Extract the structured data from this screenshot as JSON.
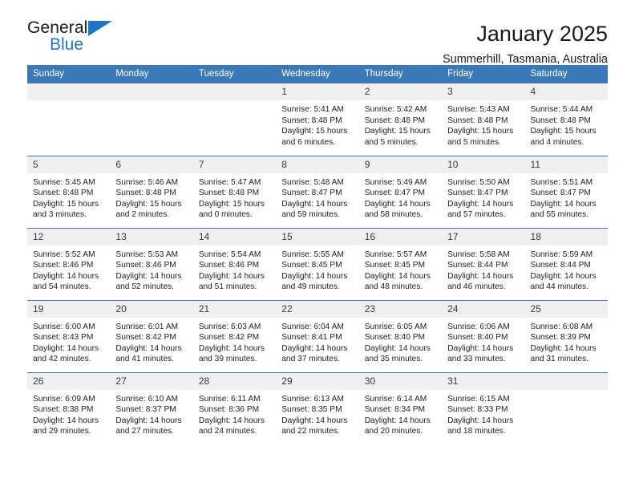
{
  "brand": {
    "name_top": "General",
    "name_bottom": "Blue",
    "triangle_color": "#1e76c8"
  },
  "header": {
    "title": "January 2025",
    "subtitle": "Summerhill, Tasmania, Australia",
    "accent_color": "#3b78b8",
    "daynum_band_color": "#f0f0f0"
  },
  "weekday_headers": [
    "Sunday",
    "Monday",
    "Tuesday",
    "Wednesday",
    "Thursday",
    "Friday",
    "Saturday"
  ],
  "labels": {
    "sunrise": "Sunrise:",
    "sunset": "Sunset:",
    "daylight": "Daylight:"
  },
  "weeks": [
    [
      {
        "day": "",
        "empty": true
      },
      {
        "day": "",
        "empty": true
      },
      {
        "day": "",
        "empty": true
      },
      {
        "day": "1",
        "sunrise": "Sunrise: 5:41 AM",
        "sunset": "Sunset: 8:48 PM",
        "daylight": "Daylight: 15 hours and 6 minutes."
      },
      {
        "day": "2",
        "sunrise": "Sunrise: 5:42 AM",
        "sunset": "Sunset: 8:48 PM",
        "daylight": "Daylight: 15 hours and 5 minutes."
      },
      {
        "day": "3",
        "sunrise": "Sunrise: 5:43 AM",
        "sunset": "Sunset: 8:48 PM",
        "daylight": "Daylight: 15 hours and 5 minutes."
      },
      {
        "day": "4",
        "sunrise": "Sunrise: 5:44 AM",
        "sunset": "Sunset: 8:48 PM",
        "daylight": "Daylight: 15 hours and 4 minutes."
      }
    ],
    [
      {
        "day": "5",
        "sunrise": "Sunrise: 5:45 AM",
        "sunset": "Sunset: 8:48 PM",
        "daylight": "Daylight: 15 hours and 3 minutes."
      },
      {
        "day": "6",
        "sunrise": "Sunrise: 5:46 AM",
        "sunset": "Sunset: 8:48 PM",
        "daylight": "Daylight: 15 hours and 2 minutes."
      },
      {
        "day": "7",
        "sunrise": "Sunrise: 5:47 AM",
        "sunset": "Sunset: 8:48 PM",
        "daylight": "Daylight: 15 hours and 0 minutes."
      },
      {
        "day": "8",
        "sunrise": "Sunrise: 5:48 AM",
        "sunset": "Sunset: 8:47 PM",
        "daylight": "Daylight: 14 hours and 59 minutes."
      },
      {
        "day": "9",
        "sunrise": "Sunrise: 5:49 AM",
        "sunset": "Sunset: 8:47 PM",
        "daylight": "Daylight: 14 hours and 58 minutes."
      },
      {
        "day": "10",
        "sunrise": "Sunrise: 5:50 AM",
        "sunset": "Sunset: 8:47 PM",
        "daylight": "Daylight: 14 hours and 57 minutes."
      },
      {
        "day": "11",
        "sunrise": "Sunrise: 5:51 AM",
        "sunset": "Sunset: 8:47 PM",
        "daylight": "Daylight: 14 hours and 55 minutes."
      }
    ],
    [
      {
        "day": "12",
        "sunrise": "Sunrise: 5:52 AM",
        "sunset": "Sunset: 8:46 PM",
        "daylight": "Daylight: 14 hours and 54 minutes."
      },
      {
        "day": "13",
        "sunrise": "Sunrise: 5:53 AM",
        "sunset": "Sunset: 8:46 PM",
        "daylight": "Daylight: 14 hours and 52 minutes."
      },
      {
        "day": "14",
        "sunrise": "Sunrise: 5:54 AM",
        "sunset": "Sunset: 8:46 PM",
        "daylight": "Daylight: 14 hours and 51 minutes."
      },
      {
        "day": "15",
        "sunrise": "Sunrise: 5:55 AM",
        "sunset": "Sunset: 8:45 PM",
        "daylight": "Daylight: 14 hours and 49 minutes."
      },
      {
        "day": "16",
        "sunrise": "Sunrise: 5:57 AM",
        "sunset": "Sunset: 8:45 PM",
        "daylight": "Daylight: 14 hours and 48 minutes."
      },
      {
        "day": "17",
        "sunrise": "Sunrise: 5:58 AM",
        "sunset": "Sunset: 8:44 PM",
        "daylight": "Daylight: 14 hours and 46 minutes."
      },
      {
        "day": "18",
        "sunrise": "Sunrise: 5:59 AM",
        "sunset": "Sunset: 8:44 PM",
        "daylight": "Daylight: 14 hours and 44 minutes."
      }
    ],
    [
      {
        "day": "19",
        "sunrise": "Sunrise: 6:00 AM",
        "sunset": "Sunset: 8:43 PM",
        "daylight": "Daylight: 14 hours and 42 minutes."
      },
      {
        "day": "20",
        "sunrise": "Sunrise: 6:01 AM",
        "sunset": "Sunset: 8:42 PM",
        "daylight": "Daylight: 14 hours and 41 minutes."
      },
      {
        "day": "21",
        "sunrise": "Sunrise: 6:03 AM",
        "sunset": "Sunset: 8:42 PM",
        "daylight": "Daylight: 14 hours and 39 minutes."
      },
      {
        "day": "22",
        "sunrise": "Sunrise: 6:04 AM",
        "sunset": "Sunset: 8:41 PM",
        "daylight": "Daylight: 14 hours and 37 minutes."
      },
      {
        "day": "23",
        "sunrise": "Sunrise: 6:05 AM",
        "sunset": "Sunset: 8:40 PM",
        "daylight": "Daylight: 14 hours and 35 minutes."
      },
      {
        "day": "24",
        "sunrise": "Sunrise: 6:06 AM",
        "sunset": "Sunset: 8:40 PM",
        "daylight": "Daylight: 14 hours and 33 minutes."
      },
      {
        "day": "25",
        "sunrise": "Sunrise: 6:08 AM",
        "sunset": "Sunset: 8:39 PM",
        "daylight": "Daylight: 14 hours and 31 minutes."
      }
    ],
    [
      {
        "day": "26",
        "sunrise": "Sunrise: 6:09 AM",
        "sunset": "Sunset: 8:38 PM",
        "daylight": "Daylight: 14 hours and 29 minutes."
      },
      {
        "day": "27",
        "sunrise": "Sunrise: 6:10 AM",
        "sunset": "Sunset: 8:37 PM",
        "daylight": "Daylight: 14 hours and 27 minutes."
      },
      {
        "day": "28",
        "sunrise": "Sunrise: 6:11 AM",
        "sunset": "Sunset: 8:36 PM",
        "daylight": "Daylight: 14 hours and 24 minutes."
      },
      {
        "day": "29",
        "sunrise": "Sunrise: 6:13 AM",
        "sunset": "Sunset: 8:35 PM",
        "daylight": "Daylight: 14 hours and 22 minutes."
      },
      {
        "day": "30",
        "sunrise": "Sunrise: 6:14 AM",
        "sunset": "Sunset: 8:34 PM",
        "daylight": "Daylight: 14 hours and 20 minutes."
      },
      {
        "day": "31",
        "sunrise": "Sunrise: 6:15 AM",
        "sunset": "Sunset: 8:33 PM",
        "daylight": "Daylight: 14 hours and 18 minutes."
      },
      {
        "day": "",
        "empty": true
      }
    ]
  ]
}
